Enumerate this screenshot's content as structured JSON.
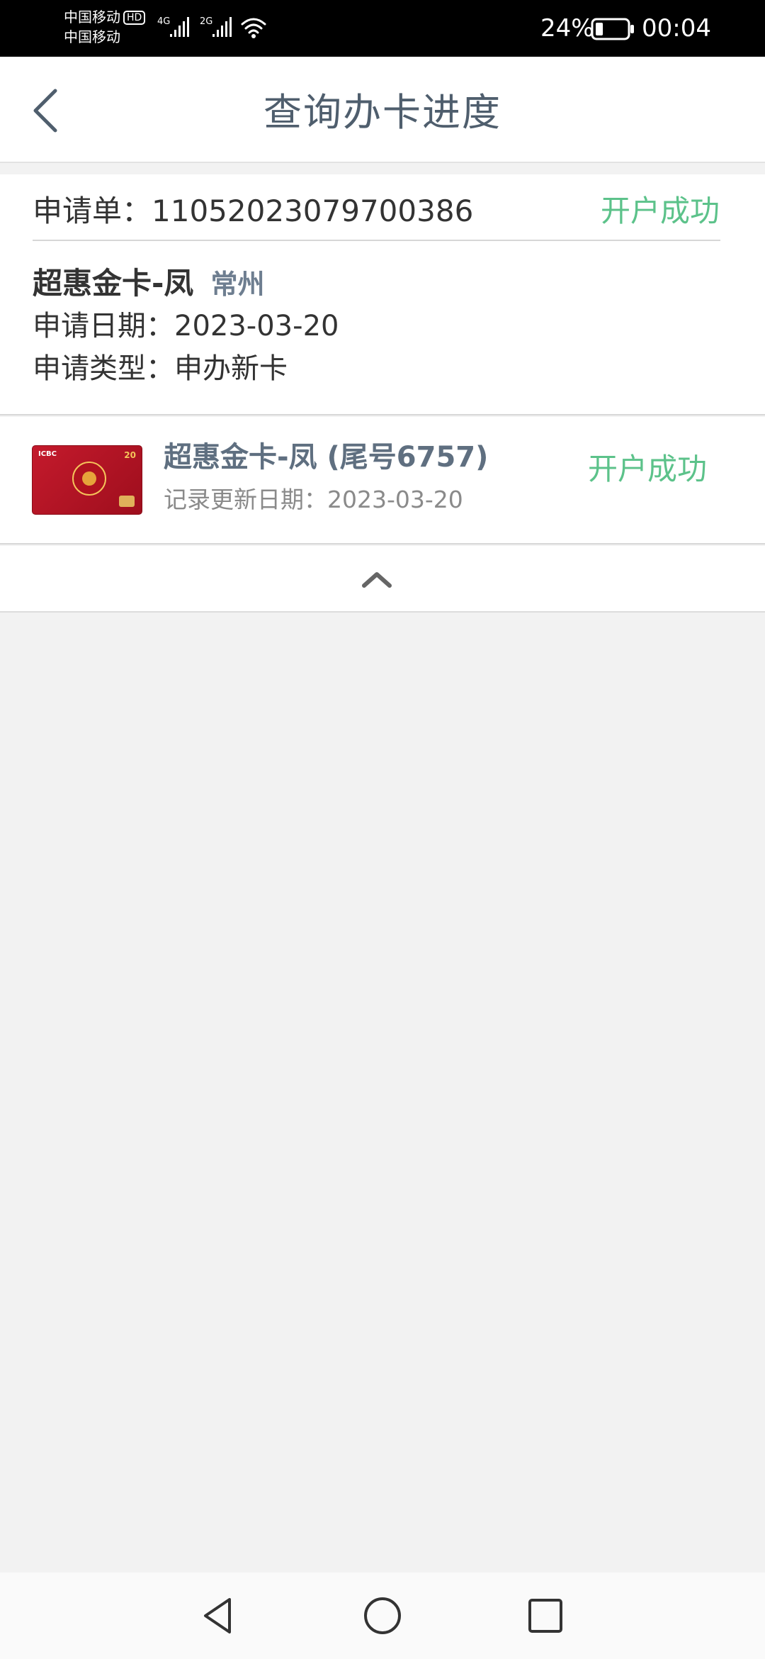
{
  "status_bar": {
    "carrier_1": "中国移动",
    "hd_badge": "HD",
    "carrier_2": "中国移动",
    "net_1": "4G",
    "net_2": "2G",
    "battery_percent": "24%",
    "battery_level": 0.24,
    "time": "00:04"
  },
  "header": {
    "title": "查询办卡进度",
    "back_icon": "chevron-left-icon"
  },
  "application": {
    "number_label": "申请单：",
    "number": "11052023079700386",
    "status": "开户成功",
    "card_name": "超惠金卡-凤",
    "city": "常州",
    "date_label": "申请日期：",
    "date": "2023-03-20",
    "type_label": "申请类型：",
    "type": "申办新卡"
  },
  "card": {
    "title": "超惠金卡-凤 (尾号6757)",
    "updated_label": "记录更新日期：",
    "updated_date": "2023-03-20",
    "status": "开户成功",
    "thumb_brand": "ICBC",
    "thumb_number": "20"
  },
  "collapse": {
    "icon": "chevron-up-icon"
  },
  "nav": {
    "back_icon": "triangle-back-icon",
    "home_icon": "circle-home-icon",
    "recent_icon": "square-recent-icon"
  },
  "colors": {
    "success_green": "#5cc28a",
    "title_gray_blue": "#4f5e6d",
    "page_background": "#f2f2f2",
    "card_red": "#c41a2c"
  }
}
